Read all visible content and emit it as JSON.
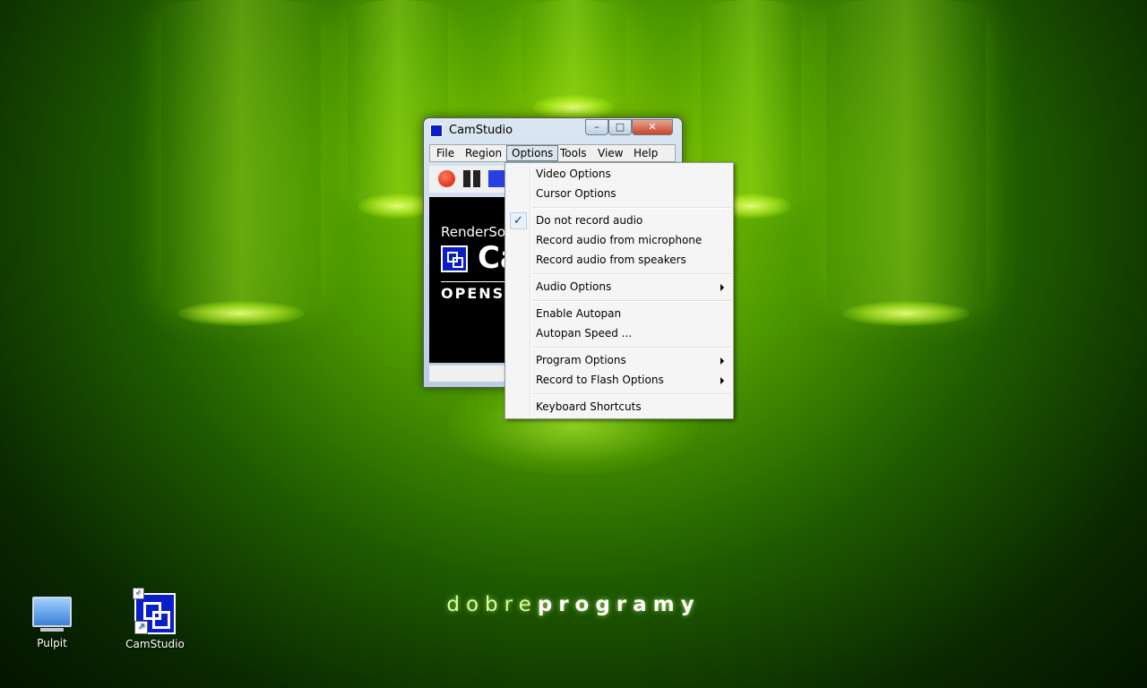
{
  "wallpaper": {
    "brand_light": "dobre",
    "brand_bold": "programy"
  },
  "desktop": {
    "icons": [
      {
        "label": "Pulpit",
        "icon": "monitor-icon"
      },
      {
        "label": "CamStudio",
        "icon": "camstudio-icon"
      }
    ]
  },
  "window": {
    "title": "CamStudio",
    "controls": {
      "minimize": "–",
      "maximize": "□",
      "close": "✕"
    },
    "menubar": [
      "File",
      "Region",
      "Options",
      "Tools",
      "View",
      "Help"
    ],
    "active_menu": "Options",
    "preview": {
      "text1": "RenderSof",
      "text2": "Ca",
      "text3": "OPENSO"
    }
  },
  "options_menu": {
    "items": [
      {
        "label": "Video Options",
        "checked": false,
        "submenu": false
      },
      {
        "label": "Cursor Options",
        "checked": false,
        "submenu": false
      },
      {
        "label": "Do not record audio",
        "checked": true,
        "submenu": false
      },
      {
        "label": "Record audio from microphone",
        "checked": false,
        "submenu": false
      },
      {
        "label": "Record audio from speakers",
        "checked": false,
        "submenu": false
      },
      {
        "label": "Audio Options",
        "checked": false,
        "submenu": true
      },
      {
        "label": "Enable Autopan",
        "checked": false,
        "submenu": false
      },
      {
        "label": "Autopan Speed ...",
        "checked": false,
        "submenu": false
      },
      {
        "label": "Program Options",
        "checked": false,
        "submenu": true
      },
      {
        "label": "Record to Flash Options",
        "checked": false,
        "submenu": true
      },
      {
        "label": "Keyboard Shortcuts",
        "checked": false,
        "submenu": false
      }
    ],
    "check_glyph": "✓"
  },
  "colors": {
    "accent_green": "#8fd000",
    "camstudio_blue": "#0a1ec8",
    "record_red": "#d11a00"
  }
}
